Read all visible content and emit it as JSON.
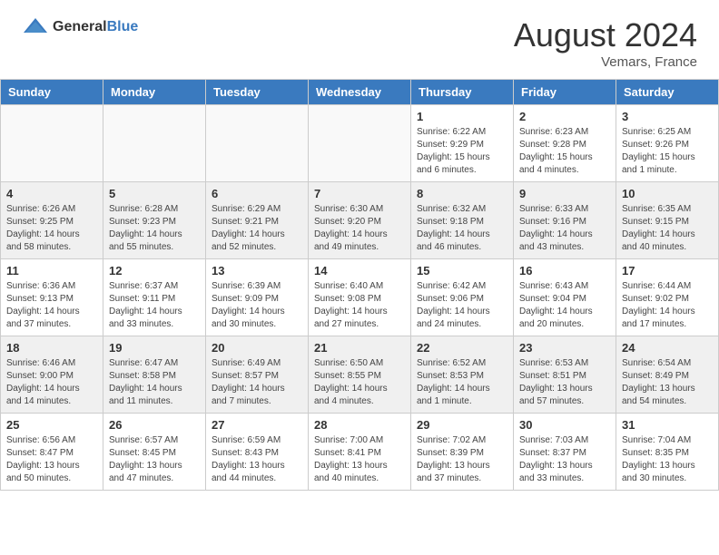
{
  "header": {
    "logo_general": "General",
    "logo_blue": "Blue",
    "month_year": "August 2024",
    "location": "Vemars, France"
  },
  "days_of_week": [
    "Sunday",
    "Monday",
    "Tuesday",
    "Wednesday",
    "Thursday",
    "Friday",
    "Saturday"
  ],
  "weeks": [
    [
      {
        "day": "",
        "info": ""
      },
      {
        "day": "",
        "info": ""
      },
      {
        "day": "",
        "info": ""
      },
      {
        "day": "",
        "info": ""
      },
      {
        "day": "1",
        "info": "Sunrise: 6:22 AM\nSunset: 9:29 PM\nDaylight: 15 hours\nand 6 minutes."
      },
      {
        "day": "2",
        "info": "Sunrise: 6:23 AM\nSunset: 9:28 PM\nDaylight: 15 hours\nand 4 minutes."
      },
      {
        "day": "3",
        "info": "Sunrise: 6:25 AM\nSunset: 9:26 PM\nDaylight: 15 hours\nand 1 minute."
      }
    ],
    [
      {
        "day": "4",
        "info": "Sunrise: 6:26 AM\nSunset: 9:25 PM\nDaylight: 14 hours\nand 58 minutes."
      },
      {
        "day": "5",
        "info": "Sunrise: 6:28 AM\nSunset: 9:23 PM\nDaylight: 14 hours\nand 55 minutes."
      },
      {
        "day": "6",
        "info": "Sunrise: 6:29 AM\nSunset: 9:21 PM\nDaylight: 14 hours\nand 52 minutes."
      },
      {
        "day": "7",
        "info": "Sunrise: 6:30 AM\nSunset: 9:20 PM\nDaylight: 14 hours\nand 49 minutes."
      },
      {
        "day": "8",
        "info": "Sunrise: 6:32 AM\nSunset: 9:18 PM\nDaylight: 14 hours\nand 46 minutes."
      },
      {
        "day": "9",
        "info": "Sunrise: 6:33 AM\nSunset: 9:16 PM\nDaylight: 14 hours\nand 43 minutes."
      },
      {
        "day": "10",
        "info": "Sunrise: 6:35 AM\nSunset: 9:15 PM\nDaylight: 14 hours\nand 40 minutes."
      }
    ],
    [
      {
        "day": "11",
        "info": "Sunrise: 6:36 AM\nSunset: 9:13 PM\nDaylight: 14 hours\nand 37 minutes."
      },
      {
        "day": "12",
        "info": "Sunrise: 6:37 AM\nSunset: 9:11 PM\nDaylight: 14 hours\nand 33 minutes."
      },
      {
        "day": "13",
        "info": "Sunrise: 6:39 AM\nSunset: 9:09 PM\nDaylight: 14 hours\nand 30 minutes."
      },
      {
        "day": "14",
        "info": "Sunrise: 6:40 AM\nSunset: 9:08 PM\nDaylight: 14 hours\nand 27 minutes."
      },
      {
        "day": "15",
        "info": "Sunrise: 6:42 AM\nSunset: 9:06 PM\nDaylight: 14 hours\nand 24 minutes."
      },
      {
        "day": "16",
        "info": "Sunrise: 6:43 AM\nSunset: 9:04 PM\nDaylight: 14 hours\nand 20 minutes."
      },
      {
        "day": "17",
        "info": "Sunrise: 6:44 AM\nSunset: 9:02 PM\nDaylight: 14 hours\nand 17 minutes."
      }
    ],
    [
      {
        "day": "18",
        "info": "Sunrise: 6:46 AM\nSunset: 9:00 PM\nDaylight: 14 hours\nand 14 minutes."
      },
      {
        "day": "19",
        "info": "Sunrise: 6:47 AM\nSunset: 8:58 PM\nDaylight: 14 hours\nand 11 minutes."
      },
      {
        "day": "20",
        "info": "Sunrise: 6:49 AM\nSunset: 8:57 PM\nDaylight: 14 hours\nand 7 minutes."
      },
      {
        "day": "21",
        "info": "Sunrise: 6:50 AM\nSunset: 8:55 PM\nDaylight: 14 hours\nand 4 minutes."
      },
      {
        "day": "22",
        "info": "Sunrise: 6:52 AM\nSunset: 8:53 PM\nDaylight: 14 hours\nand 1 minute."
      },
      {
        "day": "23",
        "info": "Sunrise: 6:53 AM\nSunset: 8:51 PM\nDaylight: 13 hours\nand 57 minutes."
      },
      {
        "day": "24",
        "info": "Sunrise: 6:54 AM\nSunset: 8:49 PM\nDaylight: 13 hours\nand 54 minutes."
      }
    ],
    [
      {
        "day": "25",
        "info": "Sunrise: 6:56 AM\nSunset: 8:47 PM\nDaylight: 13 hours\nand 50 minutes."
      },
      {
        "day": "26",
        "info": "Sunrise: 6:57 AM\nSunset: 8:45 PM\nDaylight: 13 hours\nand 47 minutes."
      },
      {
        "day": "27",
        "info": "Sunrise: 6:59 AM\nSunset: 8:43 PM\nDaylight: 13 hours\nand 44 minutes."
      },
      {
        "day": "28",
        "info": "Sunrise: 7:00 AM\nSunset: 8:41 PM\nDaylight: 13 hours\nand 40 minutes."
      },
      {
        "day": "29",
        "info": "Sunrise: 7:02 AM\nSunset: 8:39 PM\nDaylight: 13 hours\nand 37 minutes."
      },
      {
        "day": "30",
        "info": "Sunrise: 7:03 AM\nSunset: 8:37 PM\nDaylight: 13 hours\nand 33 minutes."
      },
      {
        "day": "31",
        "info": "Sunrise: 7:04 AM\nSunset: 8:35 PM\nDaylight: 13 hours\nand 30 minutes."
      }
    ]
  ]
}
